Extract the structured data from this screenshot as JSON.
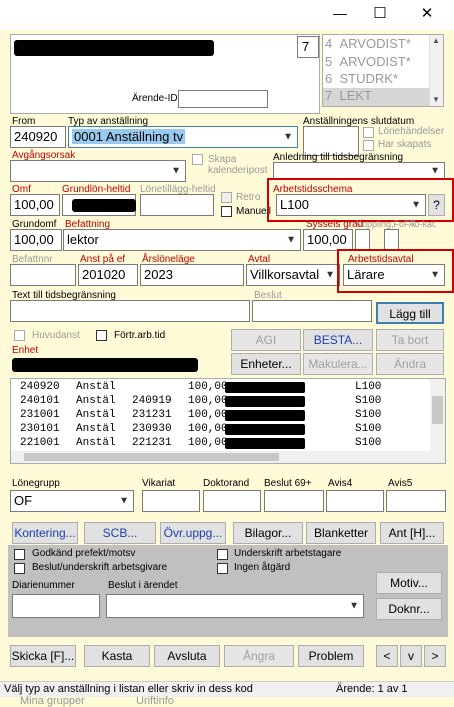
{
  "window": {
    "minimize": "—",
    "maximize": "☐",
    "close": "✕"
  },
  "person": {
    "field_num": "7"
  },
  "roles": [
    {
      "num": "4",
      "name": "ARVODIST*"
    },
    {
      "num": "5",
      "name": "ARVODIST*"
    },
    {
      "num": "6",
      "name": "STUDRK*"
    },
    {
      "num": "7",
      "name": "LEKT"
    }
  ],
  "arende_id_label": "Ärende-ID",
  "row1": {
    "from_label": "From",
    "from_value": "240920",
    "typ_label": "Typ av anställning",
    "typ_value": "0001 Anställning tv",
    "slut_label": "Anställningens slutdatum",
    "lonehandelser": "Lönehändelser",
    "har_skapats": "Har skapats"
  },
  "row2": {
    "avgangsorsak": "Avgångsorsak",
    "skapa": "Skapa",
    "kalenderipost": "kalenderipost",
    "anledning": "Anledning till tidsbegränsning"
  },
  "row3": {
    "omf_label": "Omf",
    "omf_value": "100,00",
    "grundlon_label": "Grundlön-heltid",
    "lonetillagg_label": "Lönetillägg-heltid",
    "retro": "Retro",
    "manuell": "Manuell",
    "schema_label": "Arbetstidsschema",
    "schema_value": "L100",
    "schema_btn": "?"
  },
  "row4": {
    "grundomf_label": "Grundomf",
    "grundomf_value": "100,00",
    "befattning_label": "Befattning",
    "befattning_value": "lektor",
    "syssels_label": "Syssels grad",
    "syssels_value": "100,00",
    "koppling_label": "Koppling,FoFA",
    "kat_label": "To-kat."
  },
  "row5": {
    "befattnnr_label": "Befattnnr",
    "anstpaef_label": "Anst på ef",
    "anstpaef_value": "201020",
    "arslon_label": "Årslöneläge",
    "arslon_value": "2023",
    "avtal_label": "Avtal",
    "avtal_value": "Villkorsavtal",
    "arbavtal_label": "Arbetstidsavtal",
    "arbavtal_value": "Lärare"
  },
  "row6": {
    "text_label": "Text till tidsbegränsning",
    "beslut_label": "Beslut",
    "lagg_till": "Lägg till"
  },
  "row7": {
    "huvudanst": "Huvudanst",
    "fortr": "Förtr.arb.tid",
    "agi": "AGI",
    "besta": "BESTA...",
    "ta_bort": "Ta bort"
  },
  "row8": {
    "enhet_label": "Enhet",
    "enheter": "Enheter...",
    "makulera": "Makulera...",
    "andra": "Ändra"
  },
  "history": [
    {
      "from": "240920",
      "typ": "Anstäl",
      "tom": "",
      "omf": "100,00",
      "kod": "L100"
    },
    {
      "from": "240101",
      "typ": "Anstäl",
      "tom": "240919",
      "omf": "100,00",
      "kod": "S100"
    },
    {
      "from": "231001",
      "typ": "Anstäl",
      "tom": "231231",
      "omf": "100,00",
      "kod": "S100"
    },
    {
      "from": "230101",
      "typ": "Anstäl",
      "tom": "230930",
      "omf": "100,00",
      "kod": "S100"
    },
    {
      "from": "221001",
      "typ": "Anstäl",
      "tom": "221231",
      "omf": "100,00",
      "kod": "S100"
    }
  ],
  "lower": {
    "lonegrupp_label": "Lönegrupp",
    "lonegrupp_value": "OF",
    "vikariat": "Vikariat",
    "doktorand": "Doktorand",
    "beslut69": "Beslut 69+",
    "avis4": "Avis4",
    "avis5": "Avis5"
  },
  "buttons_row": [
    "Kontering...",
    "SCB...",
    "Övr.uppg...",
    "Bilagor...",
    "Blanketter",
    "Ant [H]..."
  ],
  "checks": {
    "godkand": "Godkänd prefekt/motsv",
    "beslut_under": "Beslut/underskrift arbetsgivare",
    "underskrift": "Underskrift arbetstagare",
    "ingen": "Ingen åtgärd"
  },
  "diarie_label": "Diarienummer",
  "beslut_arende_label": "Beslut i ärendet",
  "motiv": "Motiv...",
  "doknr": "Doknr...",
  "bottom_buttons": [
    "Skicka [F]...",
    "Kasta",
    "Avsluta",
    "Ångra",
    "Problem"
  ],
  "nav": [
    "<",
    "v",
    ">"
  ],
  "status_left": "Välj typ av anställning i listan eller skriv in dess kod",
  "status_right": "Ärende: 1 av 1",
  "behind_text_1": "Mina grupper",
  "behind_text_2": "Uriftinfo"
}
